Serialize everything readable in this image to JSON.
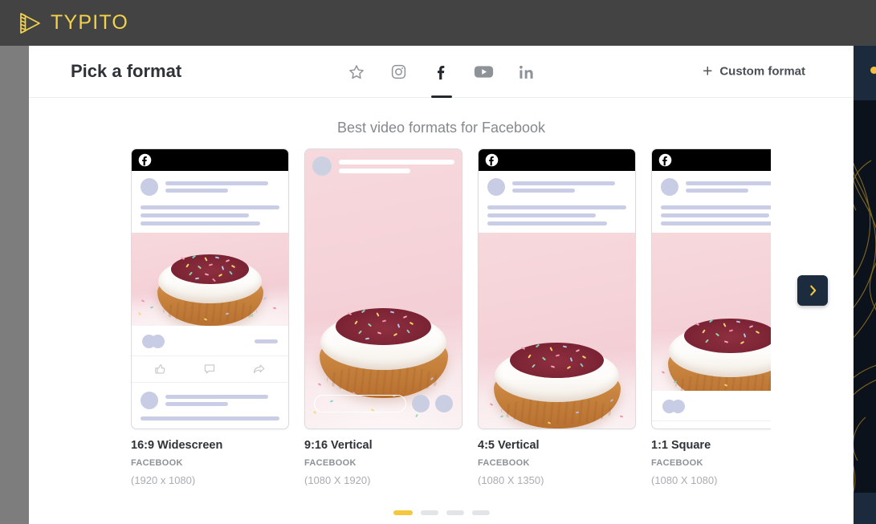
{
  "app": {
    "brand_name": "TYPITO",
    "brand_color": "#f2d24b",
    "logo_icon": "film-play-icon",
    "topbar_color": "#434343"
  },
  "modal": {
    "title": "Pick a format",
    "section_title": "Best video formats for Facebook",
    "custom_format": {
      "label": "Custom format",
      "icon": "plus-icon"
    },
    "platform_tabs": [
      {
        "id": "favorites",
        "icon": "star-icon",
        "label": "Favorites",
        "active": false
      },
      {
        "id": "instagram",
        "icon": "instagram-icon",
        "label": "Instagram",
        "active": false
      },
      {
        "id": "facebook",
        "icon": "facebook-icon",
        "label": "Facebook",
        "active": true
      },
      {
        "id": "youtube",
        "icon": "youtube-icon",
        "label": "YouTube",
        "active": false
      },
      {
        "id": "linkedin",
        "icon": "linkedin-icon",
        "label": "LinkedIn",
        "active": false
      }
    ],
    "cards": [
      {
        "title": "16:9 Widescreen",
        "platform": "FACEBOOK",
        "dimensions": "(1920 x 1080)",
        "preview": "facebook-feed-post"
      },
      {
        "title": "9:16 Vertical",
        "platform": "FACEBOOK",
        "dimensions": "(1080 X 1920)",
        "preview": "facebook-story"
      },
      {
        "title": "4:5 Vertical",
        "platform": "FACEBOOK",
        "dimensions": "(1080 X 1350)",
        "preview": "facebook-feed-post-tall"
      },
      {
        "title": "1:1 Square",
        "platform": "FACEBOOK",
        "dimensions": "(1080 X 1080)",
        "preview": "facebook-feed-post-square"
      }
    ],
    "next_arrow": {
      "icon": "chevron-right-icon",
      "glyph": "›",
      "color": "#f5c73c"
    },
    "pagination": {
      "total": 4,
      "active_index": 0,
      "active_color": "#f5c73c",
      "inactive_color": "#e2e4e7"
    }
  }
}
